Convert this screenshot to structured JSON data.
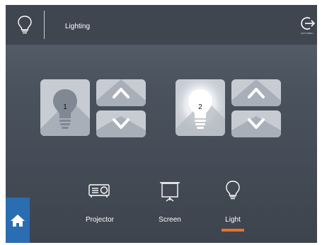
{
  "header": {
    "title": "Lighting",
    "exit_label": "EXIT MENU",
    "icon": "lightbulb-icon"
  },
  "lights": [
    {
      "label": "1",
      "state": "off"
    },
    {
      "label": "2",
      "state": "on"
    }
  ],
  "nav": {
    "items": [
      {
        "label": "Projector",
        "icon": "projector-icon"
      },
      {
        "label": "Screen",
        "icon": "projection-screen-icon"
      },
      {
        "label": "Light",
        "icon": "lightbulb-icon",
        "active": true
      }
    ],
    "home_icon": "home-icon"
  },
  "colors": {
    "accent": "#e8702a",
    "home": "#2a6db0",
    "tile": "#c7ccd3"
  }
}
